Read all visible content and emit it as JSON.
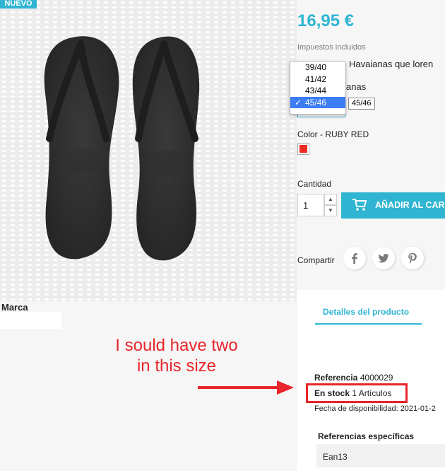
{
  "product": {
    "badge": "NUEVO",
    "price": "16,95 €",
    "tax_note": "Impuestos incluidos",
    "description_fragment": "Havaianas que loren",
    "description_fragment_2": "anas",
    "brand_label": "Marca"
  },
  "size_dropdown": {
    "options": [
      "39/40",
      "41/42",
      "43/44",
      "45/46"
    ],
    "selected_index": 3,
    "selected_mark": "✓",
    "tooltip": "45/46"
  },
  "color": {
    "label": "Color - RUBY RED",
    "swatch_color": "#ee2a24"
  },
  "quantity": {
    "label": "Cantidad",
    "value": "1",
    "add_to_cart": "AÑADIR AL CARRITO"
  },
  "share": {
    "label": "Compartir",
    "icons": [
      "facebook-icon",
      "twitter-icon",
      "pinterest-icon"
    ]
  },
  "details": {
    "tab_label": "Detalles del producto",
    "reference_label": "Referencia",
    "reference_value": "4000029",
    "stock_label": "En stock",
    "stock_value": "1 Artículos",
    "availability": "Fecha de disponibilidad: 2021-01-2",
    "specific_refs_label": "Referencias específicas",
    "ean_label": "Ean13"
  },
  "annotation": {
    "line1": "I sould have two",
    "line2": "in this size",
    "color": "#e8252a"
  },
  "theme": {
    "accent": "#2fb5d2"
  }
}
